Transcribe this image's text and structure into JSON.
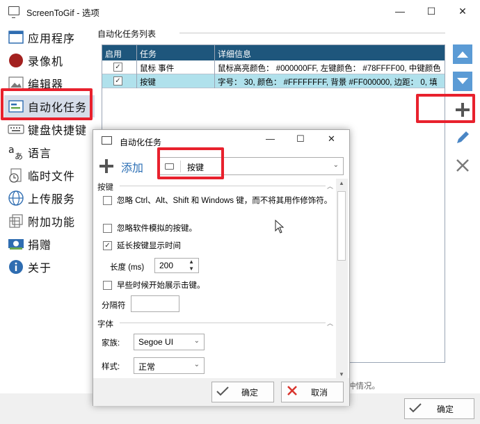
{
  "window": {
    "title": "ScreenToGif - 选项",
    "minimize": "—",
    "maximize": "☐",
    "close": "✕"
  },
  "sidebar": {
    "items": [
      {
        "label": "应用程序",
        "icon": "application-icon"
      },
      {
        "label": "录像机",
        "icon": "recorder-icon"
      },
      {
        "label": "编辑器",
        "icon": "editor-icon"
      },
      {
        "label": "自动化任务",
        "icon": "automation-icon",
        "selected": true
      },
      {
        "label": "键盘快捷键",
        "icon": "keyboard-icon"
      },
      {
        "label": "语言",
        "icon": "language-icon"
      },
      {
        "label": "临时文件",
        "icon": "temp-files-icon"
      },
      {
        "label": "上传服务",
        "icon": "upload-icon"
      },
      {
        "label": "附加功能",
        "icon": "extras-icon"
      },
      {
        "label": "捐赠",
        "icon": "donate-icon"
      },
      {
        "label": "关于",
        "icon": "info-icon"
      }
    ]
  },
  "tasks": {
    "group_title": "自动化任务列表",
    "columns": [
      "启用",
      "任务",
      "详细信息"
    ],
    "rows": [
      {
        "enabled": true,
        "task": "鼠标 事件",
        "details": "鼠标高亮颜色： #000000FF, 左键颜色： #78FFFF00, 中键颜色"
      },
      {
        "enabled": true,
        "task": "按键",
        "details": "字号： 30, 颜色： #FFFFFFFF, 背景 #FF000000, 边距： 0, 填"
      }
    ]
  },
  "footer": {
    "hint_text": "冲情况。",
    "ok_label": "确定"
  },
  "dialog": {
    "title": "自动化任务",
    "add_label": "添加",
    "task_type": "按键",
    "section_keys": "按键",
    "options": [
      {
        "text": "忽略 Ctrl、Alt、Shift 和 Windows 键，而不将其用作修饰符。",
        "checked": false
      },
      {
        "text": "忽略软件模拟的按键。",
        "checked": false
      },
      {
        "text": "延长按键显示时间",
        "checked": true
      }
    ],
    "length_label": "长度 (ms)",
    "length_value": "200",
    "early_start": {
      "text": "早些时候开始展示击键。",
      "checked": false
    },
    "separator_label": "分隔符",
    "separator_value": "",
    "section_font": "字体",
    "family_label": "家族:",
    "family_value": "Segoe UI",
    "style_label": "样式:",
    "style_value": "正常",
    "ok_label": "确定",
    "cancel_label": "取消"
  },
  "colors": {
    "grid_header": "#1e567c",
    "selected_row": "#b0e1ec",
    "highlight": "#e8212d",
    "accent": "#5b9bd5"
  }
}
